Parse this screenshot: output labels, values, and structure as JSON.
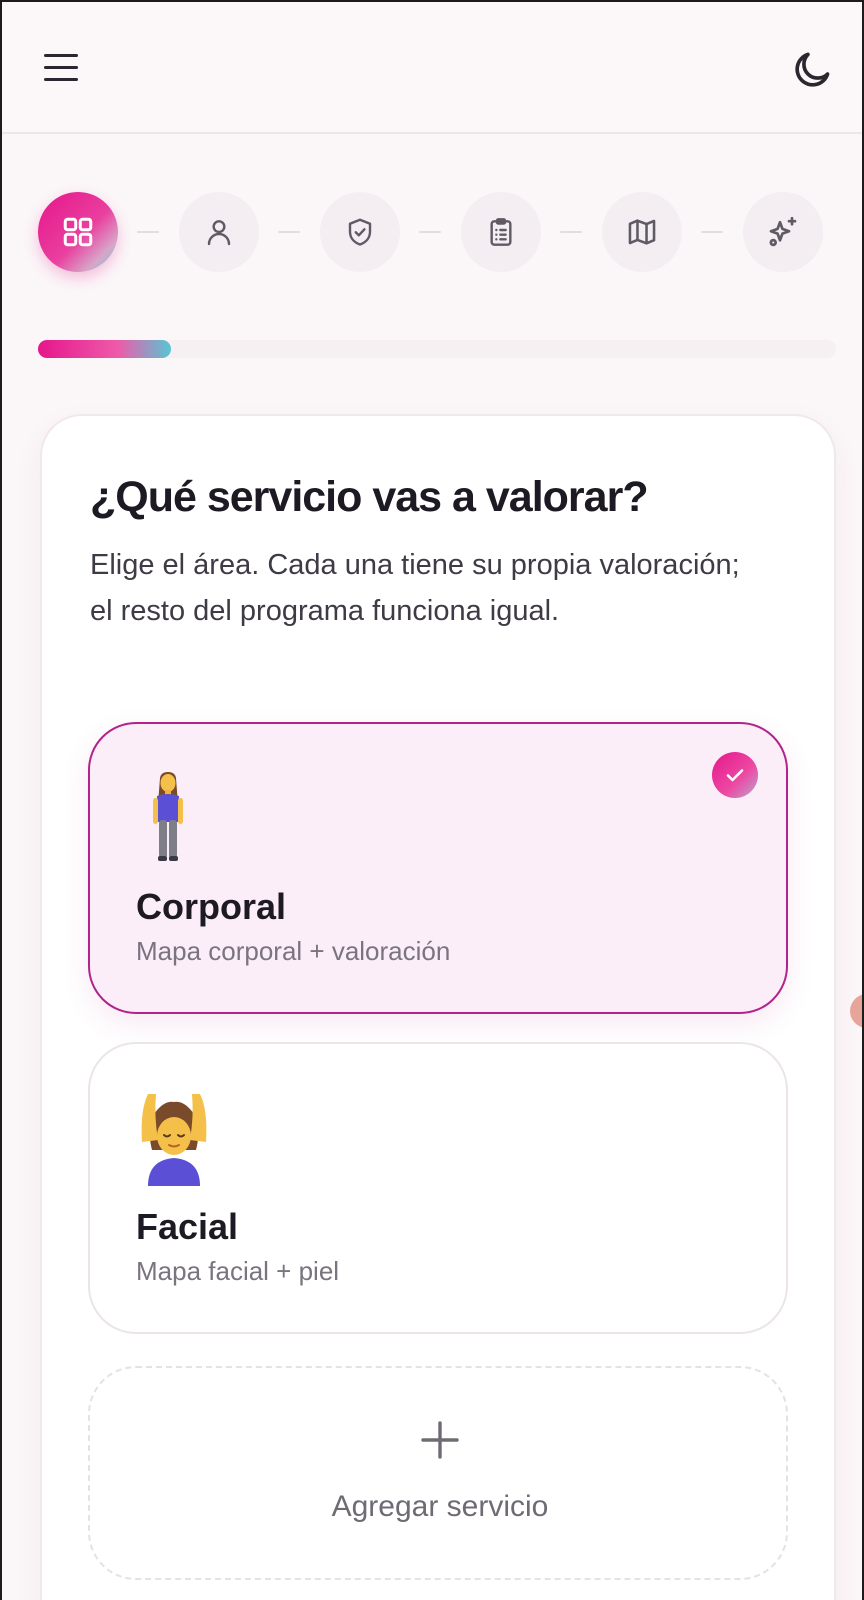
{
  "header": {
    "menu_icon": "hamburger-menu-icon",
    "theme_icon": "moon-icon"
  },
  "stepper": {
    "steps": [
      {
        "icon": "grid-icon",
        "active": true
      },
      {
        "icon": "user-icon",
        "active": false
      },
      {
        "icon": "shield-check-icon",
        "active": false
      },
      {
        "icon": "clipboard-list-icon",
        "active": false
      },
      {
        "icon": "map-icon",
        "active": false
      },
      {
        "icon": "sparkles-icon",
        "active": false
      }
    ]
  },
  "progress": {
    "fraction": 0.167
  },
  "main": {
    "title": "¿Qué servicio vas a valorar?",
    "subtitle": "Elige el área. Cada una tiene su propia valoración; el resto del programa funciona igual."
  },
  "services": [
    {
      "name": "Corporal",
      "description": "Mapa corporal + valoración",
      "selected": true,
      "icon": "woman-standing-icon"
    },
    {
      "name": "Facial",
      "description": "Mapa facial + piel",
      "selected": false,
      "icon": "woman-facial-massage-icon"
    }
  ],
  "add_service": {
    "label": "Agregar servicio",
    "icon": "plus-icon"
  },
  "colors": {
    "accent": "#e5168b",
    "accent_secondary": "#57c5d4",
    "selected_border": "#b2238a",
    "selected_bg": "#fbeef8"
  }
}
